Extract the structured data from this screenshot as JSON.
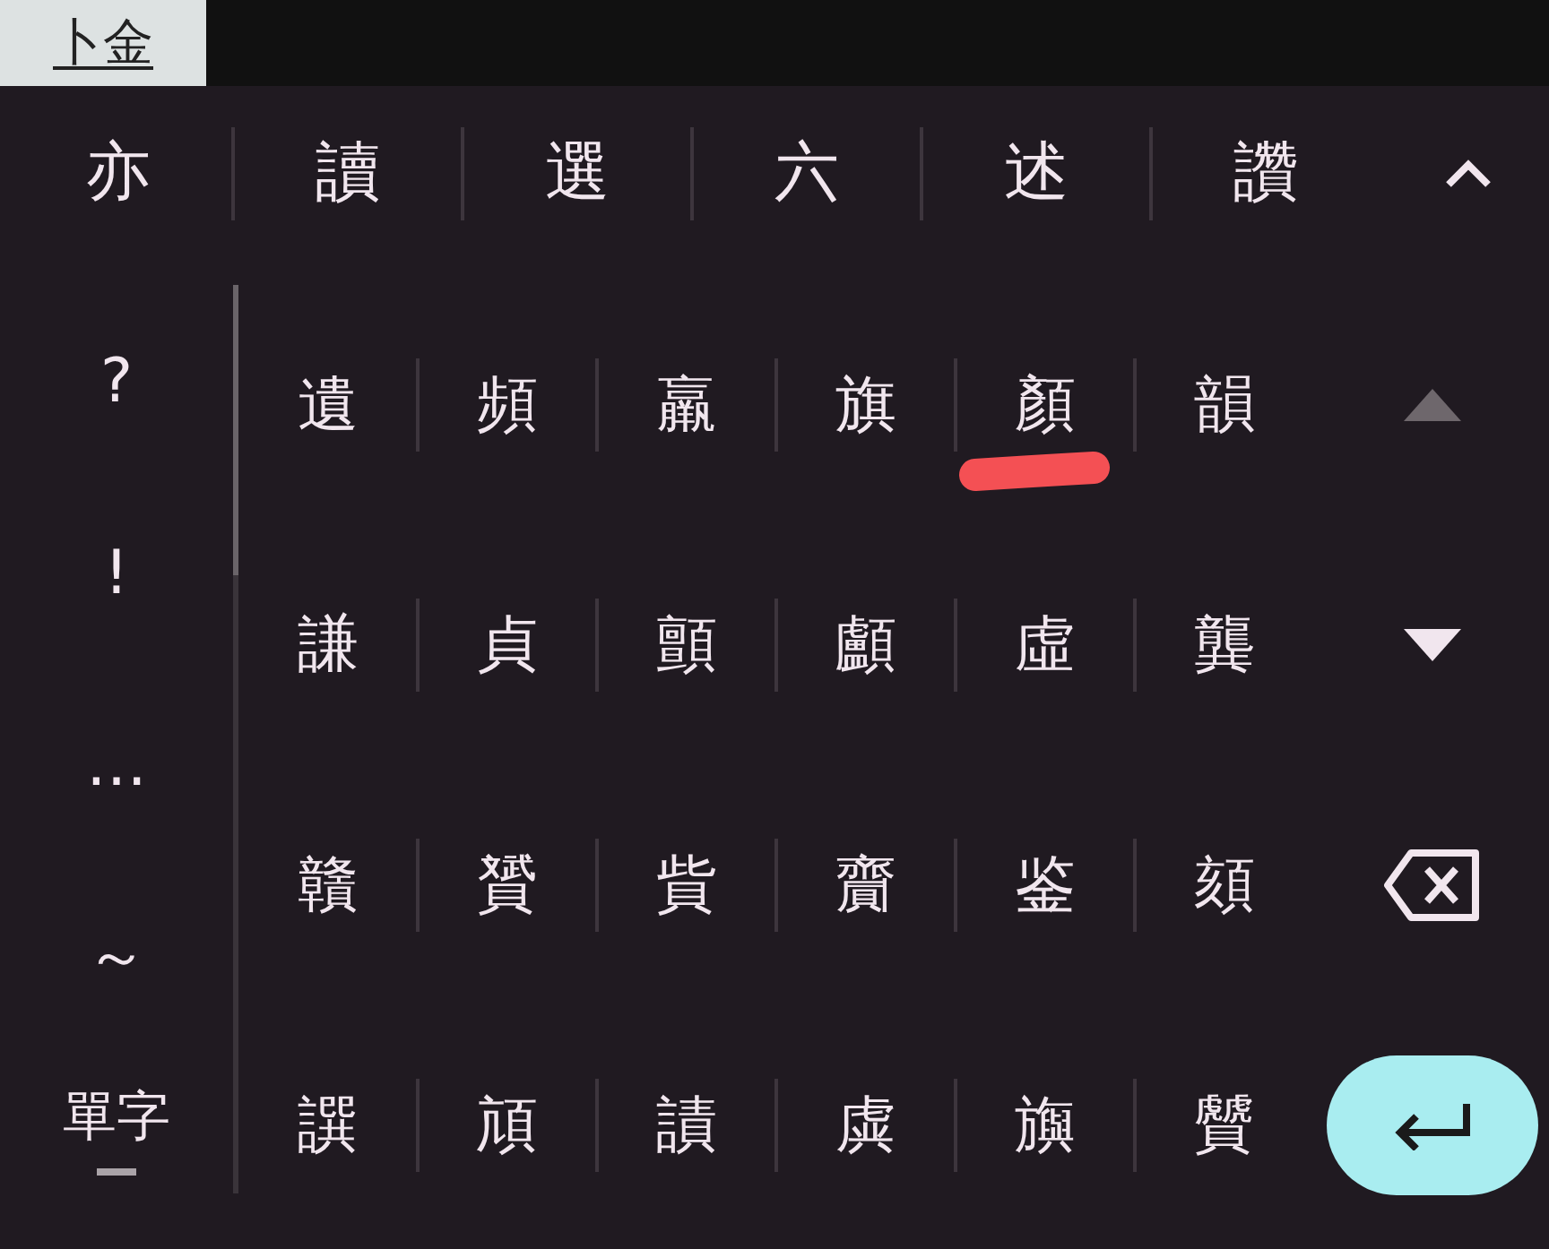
{
  "composing": {
    "text": "卜金"
  },
  "candidate_bar": {
    "candidates": [
      "亦",
      "讀",
      "選",
      "六",
      "述",
      "讚"
    ]
  },
  "symbols": [
    "?",
    "!",
    "…",
    "～"
  ],
  "mode": {
    "label": "單字",
    "on": true
  },
  "grid": {
    "rows": [
      [
        "遺",
        "頻",
        "羸",
        "旗",
        "顏",
        "韻"
      ],
      [
        "謙",
        "貞",
        "顫",
        "顱",
        "虛",
        "龔"
      ],
      [
        "贛",
        "贇",
        "貲",
        "齎",
        "鉴",
        "頦"
      ],
      [
        "譔",
        "頏",
        "謮",
        "虡",
        "旟",
        "贙"
      ]
    ]
  },
  "page_up": {
    "disabled": true
  },
  "page_down": {
    "disabled": false
  }
}
